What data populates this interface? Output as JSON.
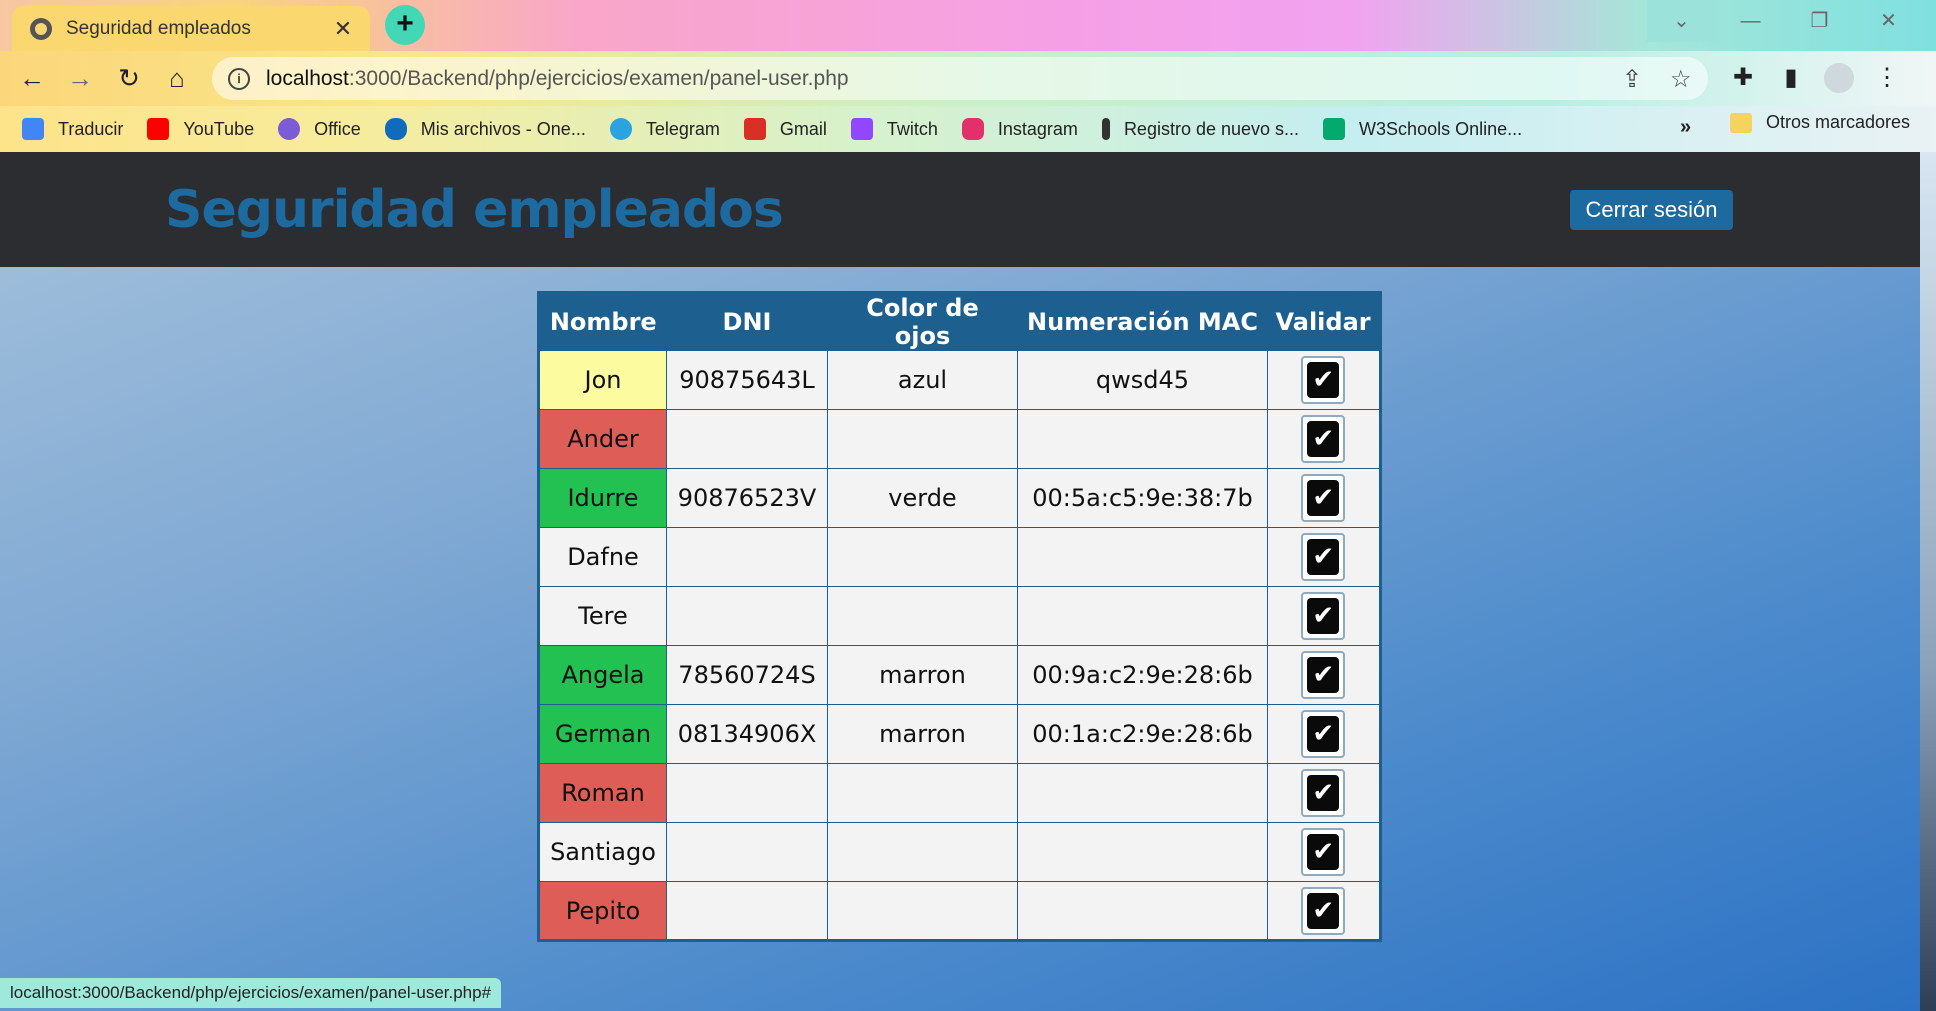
{
  "browser": {
    "tab_title": "Seguridad empleados",
    "tab_close": "✕",
    "new_tab": "+",
    "url_host": "localhost",
    "url_path": ":3000/Backend/php/ejercicios/examen/panel-user.php",
    "bookmarks": [
      {
        "label": "Traducir",
        "color": "#4285f4"
      },
      {
        "label": "YouTube",
        "color": "#ff0000"
      },
      {
        "label": "Office",
        "color": "#7b5cd6"
      },
      {
        "label": "Mis archivos - One...",
        "color": "#0f6cbd"
      },
      {
        "label": "Telegram",
        "color": "#2aa3e0"
      },
      {
        "label": "Gmail",
        "color": "#d93025"
      },
      {
        "label": "Twitch",
        "color": "#9146ff"
      },
      {
        "label": "Instagram",
        "color": "#e1306c"
      },
      {
        "label": "Registro de nuevo s...",
        "color": "#333333"
      },
      {
        "label": "W3Schools Online...",
        "color": "#04aa6d"
      }
    ],
    "bookmarks_more": "»",
    "other_bookmarks": "Otros marcadores",
    "status_url": "localhost:3000/Backend/php/ejercicios/examen/panel-user.php#"
  },
  "header": {
    "title": "Seguridad empleados",
    "logout_label": "Cerrar sesión"
  },
  "table": {
    "columns": [
      "Nombre",
      "DNI",
      "Color de ojos",
      "Numeración MAC",
      "Validar"
    ],
    "rows": [
      {
        "name": "Jon",
        "dni": "90875643L",
        "eyes": "azul",
        "mac": "qwsd45",
        "status": "yellow",
        "checked": true
      },
      {
        "name": "Ander",
        "dni": "",
        "eyes": "",
        "mac": "",
        "status": "red",
        "checked": true
      },
      {
        "name": "Idurre",
        "dni": "90876523V",
        "eyes": "verde",
        "mac": "00:5a:c5:9e:38:7b",
        "status": "green",
        "checked": true
      },
      {
        "name": "Dafne",
        "dni": "",
        "eyes": "",
        "mac": "",
        "status": "none",
        "checked": true
      },
      {
        "name": "Tere",
        "dni": "",
        "eyes": "",
        "mac": "",
        "status": "none",
        "checked": true
      },
      {
        "name": "Angela",
        "dni": "78560724S",
        "eyes": "marron",
        "mac": "00:9a:c2:9e:28:6b",
        "status": "green",
        "checked": true
      },
      {
        "name": "German",
        "dni": "08134906X",
        "eyes": "marron",
        "mac": "00:1a:c2:9e:28:6b",
        "status": "green",
        "checked": true
      },
      {
        "name": "Roman",
        "dni": "",
        "eyes": "",
        "mac": "",
        "status": "red",
        "checked": true
      },
      {
        "name": "Santiago",
        "dni": "",
        "eyes": "",
        "mac": "",
        "status": "none",
        "checked": true
      },
      {
        "name": "Pepito",
        "dni": "",
        "eyes": "",
        "mac": "",
        "status": "red",
        "checked": true
      }
    ]
  },
  "colors": {
    "accent": "#1c6aa0",
    "header_bg": "#2b2d30",
    "status_yellow": "#fdfba0",
    "status_red": "#de5e57",
    "status_green": "#22c152"
  }
}
